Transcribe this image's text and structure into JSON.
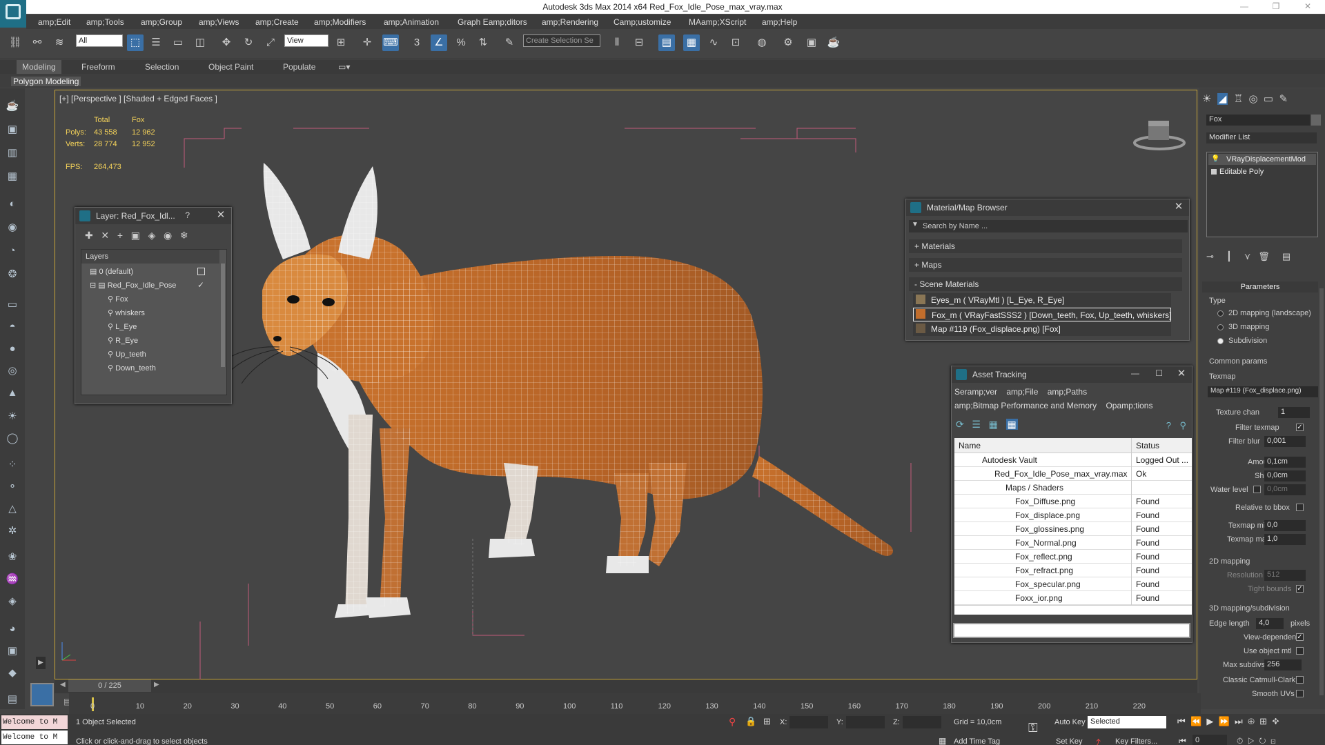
{
  "window": {
    "title": "Autodesk 3ds Max  2014 x64     Red_Fox_Idle_Pose_max_vray.max"
  },
  "menu": [
    {
      "label": "amp;Edit"
    },
    {
      "label": "amp;Tools"
    },
    {
      "label": "amp;Group"
    },
    {
      "label": "amp;Views"
    },
    {
      "label": "amp;Create"
    },
    {
      "label": "amp;Modifiers"
    },
    {
      "label": "amp;Animation"
    },
    {
      "label": "Graph Eamp;ditors"
    },
    {
      "label": "amp;Rendering"
    },
    {
      "label": "Camp;ustomize"
    },
    {
      "label": "MAamp;XScript"
    },
    {
      "label": "amp;Help"
    }
  ],
  "toolbar": {
    "filter_value": "All",
    "refcoord_value": "View",
    "selection_set_placeholder": "Create Selection Se"
  },
  "ribbon": {
    "tabs": [
      "Modeling",
      "Freeform",
      "Selection",
      "Object Paint",
      "Populate"
    ],
    "sub": "Polygon Modeling"
  },
  "viewport": {
    "label": "[+] [Perspective ] [Shaded + Edged Faces ]",
    "stats": {
      "h_total": "Total",
      "h_sel": "Fox",
      "polys_label": "Polys:",
      "polys_total": "43 558",
      "polys_sel": "12 962",
      "verts_label": "Verts:",
      "verts_total": "28 774",
      "verts_sel": "12 952",
      "fps_label": "FPS:",
      "fps": "264,473"
    }
  },
  "layer_window": {
    "title": "Layer: Red_Fox_Idl...",
    "help": "?",
    "header": "Layers",
    "rows": [
      "0 (default)",
      "Red_Fox_Idle_Pose",
      "Fox",
      "whiskers",
      "L_Eye",
      "R_Eye",
      "Up_teeth",
      "Down_teeth"
    ]
  },
  "material_browser": {
    "title": "Material/Map Browser",
    "search_placeholder": "Search by Name ...",
    "sections": [
      "+ Materials",
      "+ Maps",
      "- Scene Materials"
    ],
    "items": [
      "Eyes_m  ( VRayMtl ) [L_Eye, R_Eye]",
      "Fox_m  ( VRayFastSSS2 ) [Down_teeth, Fox, Up_teeth, whiskers]",
      "Map #119 (Fox_displace.png)  [Fox]"
    ]
  },
  "asset_tracking": {
    "title": "Asset Tracking",
    "menu1": [
      "Seramp;ver",
      "amp;File",
      "amp;Paths"
    ],
    "menu2": [
      "amp;Bitmap Performance and Memory",
      "Opamp;tions"
    ],
    "col_name": "Name",
    "col_status": "Status",
    "rows": [
      {
        "name": "Autodesk Vault",
        "status": "Logged Out ..."
      },
      {
        "name": "Red_Fox_Idle_Pose_max_vray.max",
        "status": "Ok"
      },
      {
        "name": "Maps / Shaders",
        "status": ""
      },
      {
        "name": "Fox_Diffuse.png",
        "status": "Found"
      },
      {
        "name": "Fox_displace.png",
        "status": "Found"
      },
      {
        "name": "Fox_glossines.png",
        "status": "Found"
      },
      {
        "name": "Fox_Normal.png",
        "status": "Found"
      },
      {
        "name": "Fox_reflect.png",
        "status": "Found"
      },
      {
        "name": "Fox_refract.png",
        "status": "Found"
      },
      {
        "name": "Fox_specular.png",
        "status": "Found"
      },
      {
        "name": "Foxx_ior.png",
        "status": "Found"
      }
    ]
  },
  "command_panel": {
    "object_name": "Fox",
    "modifier_list": "Modifier List",
    "stack": [
      "VRayDisplacementMod",
      "Editable Poly"
    ],
    "rollout": "Parameters",
    "type_label": "Type",
    "type_options": [
      "2D mapping (landscape)",
      "3D mapping",
      "Subdivision"
    ],
    "common_params": "Common params",
    "texmap_label": "Texmap",
    "texmap_value": "Map #119 (Fox_displace.png)",
    "texture_chan_label": "Texture chan",
    "texture_chan": "1",
    "filter_texmap": "Filter texmap",
    "filter_blur_label": "Filter blur",
    "filter_blur": "0,001",
    "amount_label": "Amount",
    "amount": "0,1cm",
    "shift_label": "Shift",
    "shift": "0,0cm",
    "water_level_label": "Water level",
    "water_level": "0,0cm",
    "relative_bbox": "Relative to bbox",
    "texmap_min_label": "Texmap min",
    "texmap_min": "0,0",
    "texmap_max_label": "Texmap max",
    "texmap_max": "1,0",
    "mapping2d": "2D mapping",
    "resolution_label": "Resolution",
    "resolution": "512",
    "tight_bounds": "Tight bounds",
    "mapping3d": "3D mapping/subdivision",
    "edge_length_label": "Edge length",
    "edge_length": "4,0",
    "pixels": "pixels",
    "view_dependent": "View-dependent",
    "use_object_mtl": "Use object mtl",
    "max_subdivs_label": "Max subdivs",
    "max_subdivs": "256",
    "classic_catmull": "Classic Catmull-Clark",
    "smooth_uvs": "Smooth UVs"
  },
  "timeline": {
    "frame": "0 / 225",
    "ticks": [
      "0",
      "10",
      "20",
      "30",
      "40",
      "50",
      "60",
      "70",
      "80",
      "90",
      "100",
      "110",
      "120",
      "130",
      "140",
      "150",
      "160",
      "170",
      "180",
      "190",
      "200",
      "210",
      "220"
    ]
  },
  "status": {
    "maxscript": "Welcome to M",
    "selected": "1 Object Selected",
    "prompt": "Click or click-and-drag to select objects",
    "x_label": "X:",
    "y_label": "Y:",
    "z_label": "Z:",
    "grid": "Grid = 10,0cm",
    "add_time_tag": "Add Time Tag",
    "auto_key": "Auto Key",
    "set_key": "Set Key",
    "key_mode": "Selected",
    "key_filters": "Key Filters...",
    "current_frame": "0"
  }
}
